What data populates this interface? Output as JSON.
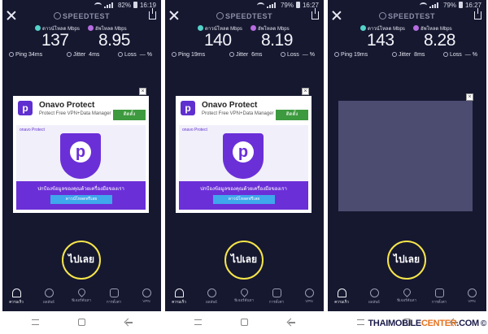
{
  "colors": {
    "background": "#161830",
    "download_accent": "#53d3c9",
    "upload_accent": "#b76ce0",
    "go_ring": "#f6e54a",
    "ad_purple": "#6b2fd8",
    "ad_install": "#3d9a3e"
  },
  "brand": "SPEEDTEST",
  "labels": {
    "download": "ดาวน์โหลด Mbps",
    "upload": "อัพโหลด Mbps",
    "ping": "Ping",
    "jitter": "Jitter",
    "loss": "Loss",
    "loss_value": "— %",
    "go": "ไปเลย"
  },
  "nav": {
    "items": [
      "ความเร็ว",
      "ผลลัพธ์",
      "ฟีเจอร์ค้นหา",
      "การตั้งค่า",
      "VPN"
    ],
    "icons": [
      "gauge-icon",
      "check-circle-icon",
      "map-pin-icon",
      "gear-icon",
      "globe-icon"
    ]
  },
  "ad": {
    "title": "Onavo Protect",
    "subtitle": "Protect Free VPN+Data Manager",
    "install": "ติดตั้ง",
    "banner_brand": "onavo Protect",
    "tagline": "ปกป้องข้อมูลของคุณด้วยเครื่องมือของเรา",
    "cta": "ดาวน์โหลดฟรีเลย"
  },
  "screens": [
    {
      "status": {
        "battery": "82%",
        "time": "16:19"
      },
      "download": "137",
      "upload": "8.95",
      "ping": "34ms",
      "jitter": "4ms",
      "ad_state": "loaded"
    },
    {
      "status": {
        "battery": "79%",
        "time": "16:27"
      },
      "download": "140",
      "upload": "8.19",
      "ping": "19ms",
      "jitter": "6ms",
      "ad_state": "loaded"
    },
    {
      "status": {
        "battery": "79%",
        "time": "16:27"
      },
      "download": "143",
      "upload": "8.28",
      "ping": "19ms",
      "jitter": "8ms",
      "ad_state": "empty"
    }
  ],
  "watermark": {
    "main": "THAIMOBILE",
    "accent": "CENTER",
    "suffix": ".COM",
    "copyright": "©"
  }
}
